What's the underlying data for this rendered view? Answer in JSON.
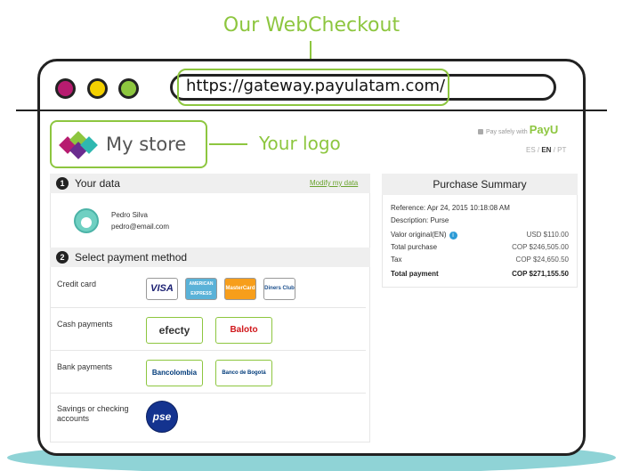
{
  "callouts": {
    "webcheckout": "Our WebCheckout",
    "logo": "Your logo"
  },
  "browser": {
    "url": "https://gateway.payulatam.com/"
  },
  "store": {
    "name": "My store"
  },
  "payu": {
    "pay_safely": "Pay safely with",
    "brand": "PayU",
    "languages": [
      "ES",
      "EN",
      "PT"
    ],
    "active_language": "EN"
  },
  "your_data": {
    "step": "1",
    "title": "Your data",
    "modify_label": "Modify my data",
    "name": "Pedro Silva",
    "email": "pedro@email.com"
  },
  "payment": {
    "step": "2",
    "title": "Select payment method",
    "methods": [
      {
        "label": "Credit card",
        "options": [
          "VISA",
          "AMERICAN EXPRESS",
          "MasterCard",
          "Diners Club"
        ]
      },
      {
        "label": "Cash payments",
        "options": [
          "efecty",
          "Baloto"
        ]
      },
      {
        "label": "Bank payments",
        "options": [
          "Bancolombia",
          "Banco de Bogotá"
        ]
      },
      {
        "label": "Savings or checking accounts",
        "options": [
          "pse"
        ]
      }
    ]
  },
  "summary": {
    "title": "Purchase Summary",
    "reference": "Reference: Apr 24, 2015 10:18:08 AM",
    "description": "Description: Purse",
    "rows": [
      {
        "label": "Valor original(EN)",
        "value": "USD $110.00"
      },
      {
        "label": "Total purchase",
        "value": "COP $246,505.00"
      },
      {
        "label": "Tax",
        "value": "COP $24,650.50"
      }
    ],
    "total_label": "Total payment",
    "total_value": "COP $271,155.50"
  },
  "colors": {
    "accent": "#8dc63f",
    "magenta": "#b71c70",
    "yellow": "#f3d000",
    "info": "#2c9bd6"
  }
}
